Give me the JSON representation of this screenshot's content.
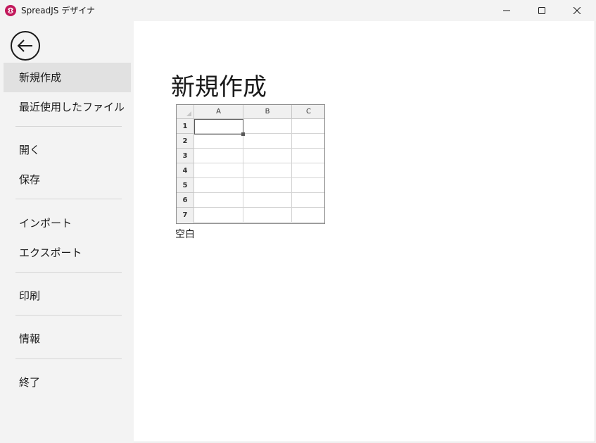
{
  "window": {
    "title": "SpreadJS デザイナ",
    "app_icon": "spreadjs-logo-icon",
    "brand_color": "#c2185b",
    "controls": [
      "minimize-icon",
      "maximize-icon",
      "close-icon"
    ]
  },
  "sidebar": {
    "back_icon": "back-arrow-icon",
    "items": [
      {
        "label": "新規作成",
        "selected": true
      },
      {
        "label": "最近使用したファイル"
      },
      {
        "label": "開く"
      },
      {
        "label": "保存"
      },
      {
        "label": "インポート"
      },
      {
        "label": "エクスポート"
      },
      {
        "label": "印刷"
      },
      {
        "label": "情報"
      },
      {
        "label": "終了"
      }
    ]
  },
  "main": {
    "title": "新規作成",
    "templates": [
      {
        "label": "空白",
        "preview": {
          "columns": [
            "A",
            "B",
            "C"
          ],
          "rows": [
            "1",
            "2",
            "3",
            "4",
            "5",
            "6",
            "7"
          ]
        }
      }
    ]
  }
}
